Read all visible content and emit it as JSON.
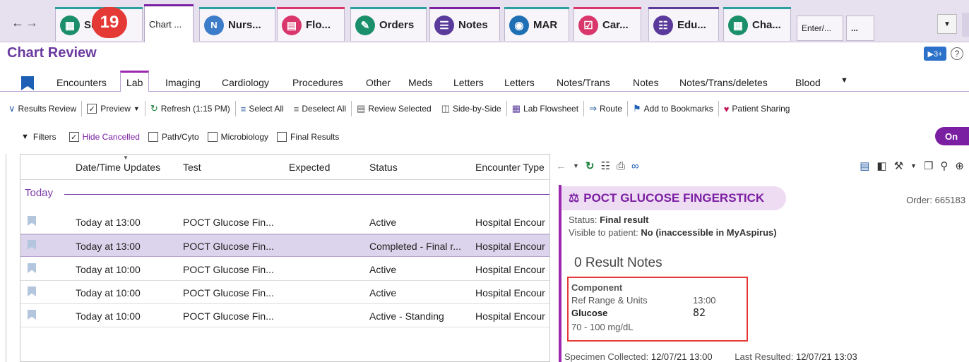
{
  "tabs": [
    {
      "label": "Su",
      "label2": "y",
      "icon": "summary-icon",
      "color": "#1a8f6a",
      "stripe": "#2aa0a0",
      "active": false
    },
    {
      "label": "Chart ...",
      "icon": "",
      "color": "",
      "stripe": "#7b1fa2",
      "active": true
    },
    {
      "label": "Nurs...",
      "icon": "N",
      "color": "#3d7cc9",
      "stripe": "#2aa0a0",
      "active": false
    },
    {
      "label": "Flo...",
      "icon": "flowsheet-icon",
      "color": "#d9366c",
      "stripe": "#d9366c",
      "active": false
    },
    {
      "label": "Orders",
      "icon": "orders-icon",
      "color": "#1a8f6a",
      "stripe": "#2aa0a0",
      "active": false
    },
    {
      "label": "Notes",
      "icon": "notes-icon",
      "color": "#5a3a9a",
      "stripe": "#7b1fa2",
      "active": false
    },
    {
      "label": "MAR",
      "icon": "mar-icon",
      "color": "#1f6fb5",
      "stripe": "#2aa0a0",
      "active": false
    },
    {
      "label": "Car...",
      "icon": "care-plan-icon",
      "color": "#d9366c",
      "stripe": "#d9366c",
      "active": false
    },
    {
      "label": "Edu...",
      "icon": "education-icon",
      "color": "#5a3a9a",
      "stripe": "#5a3a9a",
      "active": false
    },
    {
      "label": "Cha...",
      "icon": "charges-icon",
      "color": "#1a8f6a",
      "stripe": "#2aa0a0",
      "active": false
    }
  ],
  "tab_enter": "Enter/...",
  "tab_more": "...",
  "step_badge": "19",
  "activity_title": "Chart Review",
  "subtabs": [
    "Encounters",
    "Lab",
    "Imaging",
    "Cardiology",
    "Procedures",
    "Other",
    "Meds",
    "Letters",
    "Letters",
    "Notes/Trans",
    "Notes",
    "Notes/Trans/deletes",
    "Blood"
  ],
  "active_subtab": "Lab",
  "toolbar": {
    "results_review": "Results Review",
    "preview": "Preview",
    "refresh": "Refresh (1:15 PM)",
    "select_all": "Select All",
    "deselect_all": "Deselect All",
    "review_selected": "Review Selected",
    "side_by_side": "Side-by-Side",
    "lab_flowsheet": "Lab Flowsheet",
    "route": "Route",
    "add_bookmarks": "Add to Bookmarks",
    "patient_sharing": "Patient Sharing"
  },
  "filters": {
    "filters_label": "Filters",
    "hide_cancelled": "Hide Cancelled",
    "path_cyto": "Path/Cyto",
    "microbiology": "Microbiology",
    "final_results": "Final Results",
    "toggle": "On"
  },
  "grid": {
    "columns": [
      "Date/Time Updates",
      "Test",
      "Expected",
      "Status",
      "Encounter Type"
    ],
    "group": "Today",
    "rows": [
      {
        "datetime": "Today at 13:00",
        "test": "POCT Glucose Fin...",
        "expected": "",
        "status": "Active",
        "encounter": "Hospital Encour",
        "selected": false
      },
      {
        "datetime": "Today at 13:00",
        "test": "POCT Glucose Fin...",
        "expected": "",
        "status": "Completed - Final r...",
        "encounter": "Hospital Encour",
        "selected": true
      },
      {
        "datetime": "Today at 10:00",
        "test": "POCT Glucose Fin...",
        "expected": "",
        "status": "Active",
        "encounter": "Hospital Encour",
        "selected": false
      },
      {
        "datetime": "Today at 10:00",
        "test": "POCT Glucose Fin...",
        "expected": "",
        "status": "Active",
        "encounter": "Hospital Encour",
        "selected": false
      },
      {
        "datetime": "Today at 10:00",
        "test": "POCT Glucose Fin...",
        "expected": "",
        "status": "Active - Standing",
        "encounter": "Hospital Encour",
        "selected": false
      }
    ]
  },
  "report": {
    "title": "POCT GLUCOSE FINGERSTICK",
    "order": "Order: 665183",
    "status_label": "Status:",
    "status_value": "Final result",
    "visible_label": "Visible to patient:",
    "visible_value": "No (inaccessible in MyAspirus)",
    "result_notes": "0 Result Notes",
    "component_header": "Component",
    "ref_range_label": "Ref Range & Units",
    "time": "13:00",
    "component_name": "Glucose",
    "value": "82",
    "range": "70 - 100 mg/dL",
    "specimen_label": "Specimen Collected:",
    "specimen_value": "12/07/21 13:00",
    "resulted_label": "Last Resulted:",
    "resulted_value": "12/07/21 13:03"
  },
  "colors": {
    "accent": "#7b1fa2",
    "highlight_box": "#e53935",
    "selected_row": "#dcd4ec"
  }
}
